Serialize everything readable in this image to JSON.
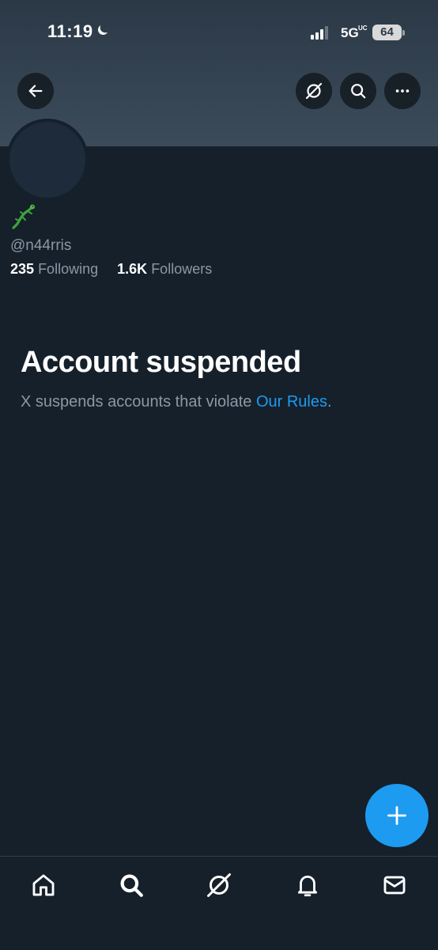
{
  "status_bar": {
    "time": "11:19",
    "network": "5G",
    "network_sub": "UC",
    "battery": "64",
    "icons": [
      "moon-icon",
      "signal-icon"
    ]
  },
  "header": {
    "buttons": [
      "back-arrow-icon",
      "grok-icon",
      "search-icon",
      "more-icon"
    ]
  },
  "profile": {
    "display_name_icon": "gecko-emoji",
    "handle": "@n44rris",
    "following_count": "235",
    "following_label": "Following",
    "followers_count": "1.6K",
    "followers_label": "Followers"
  },
  "suspension": {
    "title": "Account suspended",
    "text": "X suspends accounts that violate ",
    "link": "Our Rules",
    "period": "."
  },
  "fab": {
    "icon": "plus-icon"
  },
  "bottom_nav": {
    "items": [
      "home-icon",
      "search-icon",
      "grok-icon",
      "bell-icon",
      "mail-icon"
    ]
  },
  "colors": {
    "background": "#15202b",
    "accent": "#1d9bf0",
    "secondary_text": "#8b98a5"
  }
}
